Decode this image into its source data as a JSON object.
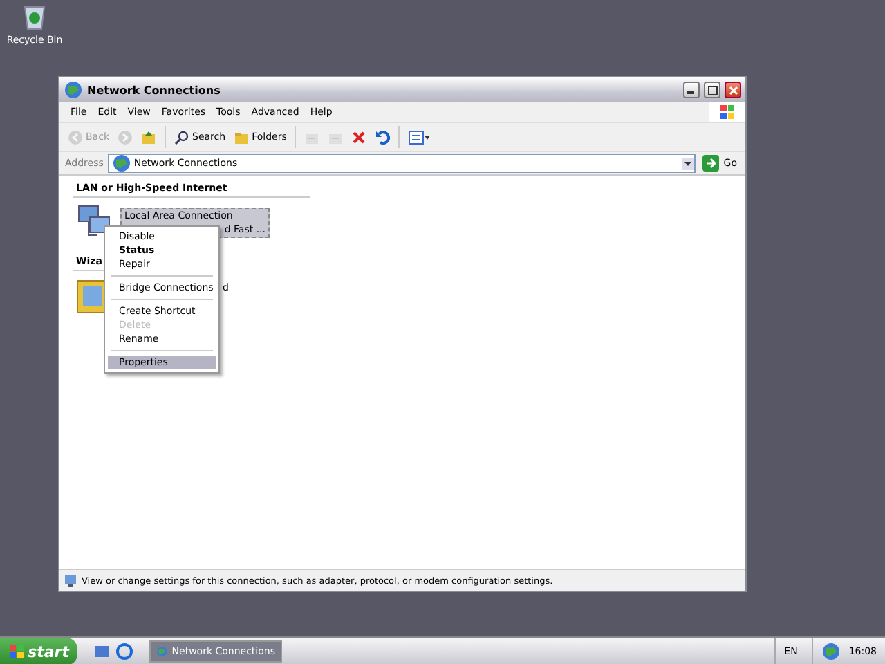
{
  "desktop_icons": [
    {
      "label": "Recycle Bin"
    }
  ],
  "window": {
    "title": "Network Connections",
    "active": true
  },
  "menu_bar": [
    "File",
    "Edit",
    "View",
    "Favorites",
    "Tools",
    "Advanced",
    "Help"
  ],
  "toolbar": [
    {
      "kind": "back",
      "label": "Back",
      "disabled": true
    },
    {
      "kind": "forward",
      "disabled": true
    },
    {
      "kind": "up",
      "disabled": false
    },
    {
      "kind": "search",
      "label": "Search",
      "disabled": false
    },
    {
      "kind": "folders",
      "label": "Folders",
      "disabled": false
    },
    {
      "kind": "move",
      "disabled": true
    },
    {
      "kind": "copy",
      "disabled": true
    },
    {
      "kind": "delete",
      "disabled": false
    },
    {
      "kind": "undo",
      "disabled": false
    },
    {
      "kind": "views",
      "disabled": false
    }
  ],
  "address_bar": {
    "label": "Address",
    "value": "Network Connections",
    "go": "Go"
  },
  "sections": [
    {
      "header": "LAN or High-Speed Internet",
      "items": [
        {
          "kind": "connection",
          "name": "Local Area Connection",
          "detail": "d Fast ...",
          "selected": true
        }
      ]
    },
    {
      "header": "Wiza",
      "items": [
        {
          "kind": "wizard",
          "name": "d"
        }
      ]
    }
  ],
  "context_menu": [
    {
      "kind": "item",
      "label": "Disable",
      "bold": false,
      "disabled": false,
      "selected": false
    },
    {
      "kind": "item",
      "label": "Status",
      "bold": true,
      "disabled": false,
      "selected": false
    },
    {
      "kind": "item",
      "label": "Repair",
      "bold": false,
      "disabled": false,
      "selected": false
    },
    {
      "kind": "separator"
    },
    {
      "kind": "item",
      "label": "Bridge Connections",
      "bold": false,
      "disabled": false,
      "selected": false
    },
    {
      "kind": "separator"
    },
    {
      "kind": "item",
      "label": "Create Shortcut",
      "bold": false,
      "disabled": false,
      "selected": false
    },
    {
      "kind": "item",
      "label": "Delete",
      "bold": false,
      "disabled": true,
      "selected": false
    },
    {
      "kind": "item",
      "label": "Rename",
      "bold": false,
      "disabled": false,
      "selected": false
    },
    {
      "kind": "separator"
    },
    {
      "kind": "item",
      "label": "Properties",
      "bold": false,
      "disabled": false,
      "selected": true
    }
  ],
  "status_bar": "View or change settings for this connection, such as adapter, protocol, or modem configuration settings.",
  "taskbar": {
    "start": "start",
    "tasks": [
      {
        "label": "Network Connections",
        "selected": true
      }
    ],
    "language": "EN",
    "clock": "16:08"
  }
}
